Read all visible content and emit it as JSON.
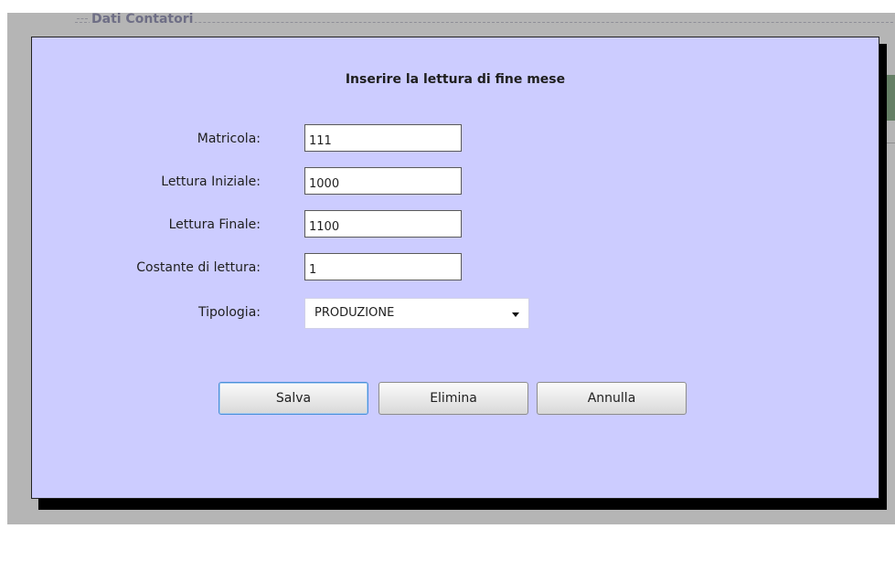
{
  "background": {
    "section_title": "Dati Contatori"
  },
  "dialog": {
    "title": "Inserire la lettura di fine mese",
    "fields": {
      "matricola": {
        "label": "Matricola:",
        "value": "111"
      },
      "lettura_iniziale": {
        "label": "Lettura Iniziale:",
        "value": "1000"
      },
      "lettura_finale": {
        "label": "Lettura Finale:",
        "value": "1100"
      },
      "costante": {
        "label": "Costante di lettura:",
        "value": "1"
      },
      "tipologia": {
        "label": "Tipologia:",
        "selected": "PRODUZIONE"
      }
    },
    "buttons": {
      "save": "Salva",
      "delete": "Elimina",
      "cancel": "Annulla"
    }
  },
  "colors": {
    "dialog_background": "#ccccff",
    "overlay": "#5a5a5a",
    "primary_button_border": "#4a90d9"
  }
}
